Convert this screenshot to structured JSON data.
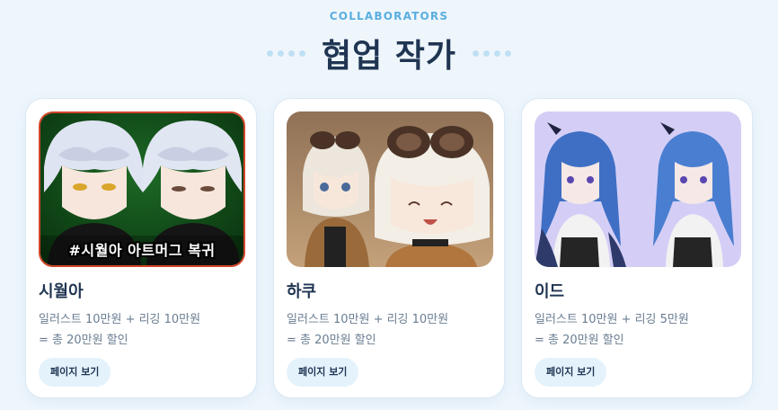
{
  "header": {
    "eyebrow": "COLLABORATORS",
    "title": "협업 작가"
  },
  "colors": {
    "accent": "#5aaee0",
    "title": "#1f3552",
    "button_bg": "#e4f2fc",
    "background": "#eef6fc"
  },
  "cards": [
    {
      "name": "시월아",
      "price_line": "일러스트 10만원 + 리깅 10만원",
      "discount_line": "= 총 20만원 할인",
      "button_label": "페이지 보기",
      "thumbnail_banner": "#시월아 아트머그 복귀",
      "thumbnail": "silver-haired-character-art"
    },
    {
      "name": "하쿠",
      "price_line": "일러스트 10만원 + 리깅 10만원",
      "discount_line": "= 총 20만원 할인",
      "button_label": "페이지 보기",
      "thumbnail": "goggles-cream-haired-character-art"
    },
    {
      "name": "이드",
      "price_line": "일러스트 10만원 + 리깅 5만원",
      "discount_line": "= 총 20만원 할인",
      "button_label": "페이지 보기",
      "thumbnail": "blue-haired-character-art"
    }
  ]
}
